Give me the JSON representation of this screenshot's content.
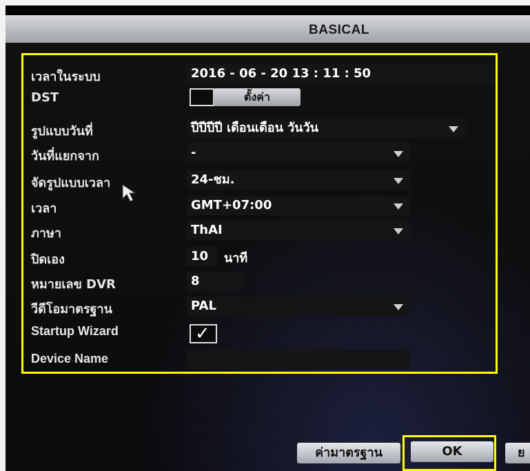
{
  "window": {
    "title": "BASICAL"
  },
  "fields": {
    "system_time": {
      "label": "เวลาในระบบ",
      "value": "2016  - 06 - 20    13 : 11 : 50"
    },
    "dst": {
      "label": "DST",
      "button_label": "ตั้งค่า",
      "checked": false
    },
    "date_format": {
      "label": "รูปแบบวันที่",
      "value": "ปีปีปีปี เดือนเดือน วันวัน"
    },
    "date_separator": {
      "label": "วันที่แยกจาก",
      "value": "-"
    },
    "time_format": {
      "label": "จัดรูปแบบเวลา",
      "value": "24-ชม."
    },
    "timezone": {
      "label": "เวลา",
      "value": "GMT+07:00"
    },
    "language": {
      "label": "ภาษา",
      "value": "ThAI"
    },
    "auto_logout": {
      "label": "ปิดเอง",
      "value": "10",
      "unit": "นาที"
    },
    "dvr_number": {
      "label": "หมายเลข DVR",
      "value": "8"
    },
    "video_standard": {
      "label": "วีดีโอมาตรฐาน",
      "value": "PAL"
    },
    "startup_wizard": {
      "label": "Startup Wizard",
      "checked": true,
      "check_glyph": "✓"
    },
    "device_name": {
      "label": "Device Name",
      "value": ""
    }
  },
  "buttons": {
    "default": "ค่ามาตรฐาน",
    "ok": "OK",
    "cancel": "ย"
  },
  "colors": {
    "highlight": "#ffff00",
    "background": "#000000",
    "title_bar": "#b4b8bd"
  },
  "icons": [
    "dropdown-arrow-icon",
    "checkmark-icon",
    "mouse-cursor-icon"
  ]
}
